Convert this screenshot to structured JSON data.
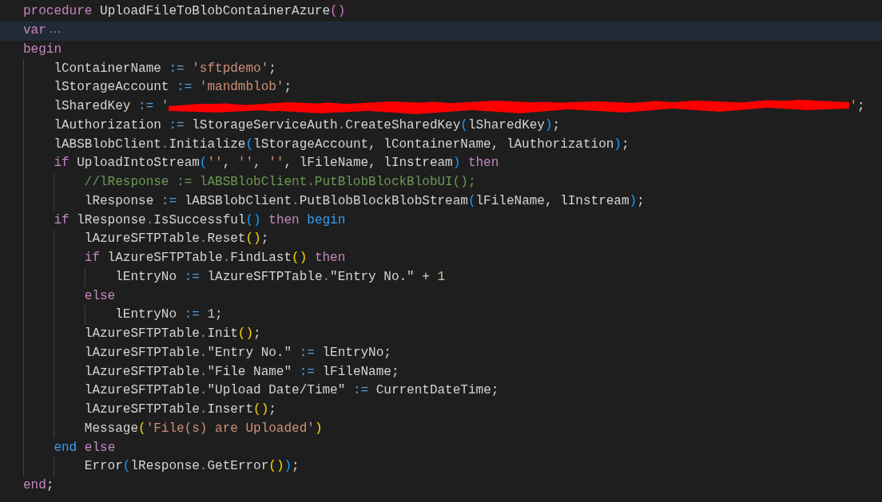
{
  "code_editor": {
    "lines": [
      {
        "current": false,
        "folded": false,
        "tokens": [
          {
            "text": "procedure",
            "kind": "keyword"
          },
          {
            "text": " UploadFileToBlobContainerAzure",
            "kind": "plain"
          },
          {
            "text": "(",
            "kind": "bracket",
            "color": "#da70d6"
          },
          {
            "text": ")",
            "kind": "bracket",
            "color": "#da70d6"
          }
        ]
      },
      {
        "current": true,
        "folded": true,
        "tokens": [
          {
            "text": "var",
            "kind": "keyword"
          }
        ]
      },
      {
        "current": false,
        "folded": false,
        "tokens": [
          {
            "text": "begin",
            "kind": "keyword"
          }
        ],
        "children": [
          {
            "current": false,
            "folded": false,
            "tokens": [
              {
                "text": "lContainerName ",
                "kind": "plain"
              },
              {
                "text": ":= ",
                "kind": "operator"
              },
              {
                "text": "'sftpdemo'",
                "kind": "string"
              },
              {
                "text": ";",
                "kind": "plain"
              }
            ]
          },
          {
            "current": false,
            "folded": false,
            "tokens": [
              {
                "text": "lStorageAccount ",
                "kind": "plain"
              },
              {
                "text": ":= ",
                "kind": "operator"
              },
              {
                "text": "'mandmblob'",
                "kind": "string"
              },
              {
                "text": ";",
                "kind": "plain"
              }
            ]
          },
          {
            "current": false,
            "folded": false,
            "tokens": [
              {
                "text": "lSharedKey ",
                "kind": "plain"
              },
              {
                "text": ":= ",
                "kind": "operator"
              },
              {
                "text": "'",
                "kind": "string"
              },
              {
                "kind": "redacted"
              },
              {
                "text": "'",
                "kind": "string"
              },
              {
                "text": ";",
                "kind": "plain"
              }
            ]
          },
          {
            "current": false,
            "folded": false,
            "tokens": [
              {
                "text": "lAuthorization ",
                "kind": "plain"
              },
              {
                "text": ":= ",
                "kind": "operator"
              },
              {
                "text": "lStorageServiceAuth",
                "kind": "plain"
              },
              {
                "text": ".",
                "kind": "operator"
              },
              {
                "text": "CreateSharedKey",
                "kind": "plain"
              },
              {
                "text": "(",
                "kind": "bracket",
                "color": "#179fff"
              },
              {
                "text": "lSharedKey",
                "kind": "plain"
              },
              {
                "text": ")",
                "kind": "bracket",
                "color": "#179fff"
              },
              {
                "text": ";",
                "kind": "plain"
              }
            ]
          },
          {
            "current": false,
            "folded": false,
            "tokens": [
              {
                "text": "lABSBlobClient",
                "kind": "plain"
              },
              {
                "text": ".",
                "kind": "operator"
              },
              {
                "text": "Initialize",
                "kind": "plain"
              },
              {
                "text": "(",
                "kind": "bracket",
                "color": "#179fff"
              },
              {
                "text": "lStorageAccount, lContainerName, lAuthorization",
                "kind": "plain"
              },
              {
                "text": ")",
                "kind": "bracket",
                "color": "#179fff"
              },
              {
                "text": ";",
                "kind": "plain"
              }
            ]
          },
          {
            "current": false,
            "folded": false,
            "tokens": [
              {
                "text": "if",
                "kind": "keyword"
              },
              {
                "text": " UploadIntoStream",
                "kind": "plain"
              },
              {
                "text": "(",
                "kind": "bracket",
                "color": "#179fff"
              },
              {
                "text": "''",
                "kind": "string"
              },
              {
                "text": ", ",
                "kind": "plain"
              },
              {
                "text": "''",
                "kind": "string"
              },
              {
                "text": ", ",
                "kind": "plain"
              },
              {
                "text": "''",
                "kind": "string"
              },
              {
                "text": ", lFileName, lInstream",
                "kind": "plain"
              },
              {
                "text": ")",
                "kind": "bracket",
                "color": "#179fff"
              },
              {
                "text": " then",
                "kind": "keyword"
              }
            ],
            "children": [
              {
                "current": false,
                "folded": false,
                "tokens": [
                  {
                    "text": "//lResponse := lABSBlobClient.PutBlobBlockBlobUI();",
                    "kind": "comment"
                  }
                ]
              },
              {
                "current": false,
                "folded": false,
                "tokens": [
                  {
                    "text": "lResponse ",
                    "kind": "plain"
                  },
                  {
                    "text": ":= ",
                    "kind": "operator"
                  },
                  {
                    "text": "lABSBlobClient",
                    "kind": "plain"
                  },
                  {
                    "text": ".",
                    "kind": "operator"
                  },
                  {
                    "text": "PutBlobBlockBlobStream",
                    "kind": "plain"
                  },
                  {
                    "text": "(",
                    "kind": "bracket",
                    "color": "#179fff"
                  },
                  {
                    "text": "lFileName, lInstream",
                    "kind": "plain"
                  },
                  {
                    "text": ")",
                    "kind": "bracket",
                    "color": "#179fff"
                  },
                  {
                    "text": ";",
                    "kind": "plain"
                  }
                ]
              }
            ]
          },
          {
            "current": false,
            "folded": false,
            "tokens": [
              {
                "text": "if",
                "kind": "keyword"
              },
              {
                "text": " lResponse",
                "kind": "plain"
              },
              {
                "text": ".",
                "kind": "operator"
              },
              {
                "text": "IsSuccessful",
                "kind": "plain"
              },
              {
                "text": "(",
                "kind": "bracket",
                "color": "#179fff"
              },
              {
                "text": ")",
                "kind": "bracket",
                "color": "#179fff"
              },
              {
                "text": " then",
                "kind": "keyword"
              },
              {
                "text": " begin",
                "kind": "block"
              }
            ],
            "children": [
              {
                "current": false,
                "folded": false,
                "tokens": [
                  {
                    "text": "lAzureSFTPTable",
                    "kind": "plain"
                  },
                  {
                    "text": ".",
                    "kind": "operator"
                  },
                  {
                    "text": "Reset",
                    "kind": "plain"
                  },
                  {
                    "text": "(",
                    "kind": "bracket",
                    "color": "#ffd700"
                  },
                  {
                    "text": ")",
                    "kind": "bracket",
                    "color": "#ffd700"
                  },
                  {
                    "text": ";",
                    "kind": "plain"
                  }
                ]
              },
              {
                "current": false,
                "folded": false,
                "tokens": [
                  {
                    "text": "if",
                    "kind": "keyword"
                  },
                  {
                    "text": " lAzureSFTPTable",
                    "kind": "plain"
                  },
                  {
                    "text": ".",
                    "kind": "operator"
                  },
                  {
                    "text": "FindLast",
                    "kind": "plain"
                  },
                  {
                    "text": "(",
                    "kind": "bracket",
                    "color": "#ffd700"
                  },
                  {
                    "text": ")",
                    "kind": "bracket",
                    "color": "#ffd700"
                  },
                  {
                    "text": " then",
                    "kind": "keyword"
                  }
                ],
                "children": [
                  {
                    "current": false,
                    "folded": false,
                    "tokens": [
                      {
                        "text": "lEntryNo ",
                        "kind": "plain"
                      },
                      {
                        "text": ":= ",
                        "kind": "operator"
                      },
                      {
                        "text": "lAzureSFTPTable",
                        "kind": "plain"
                      },
                      {
                        "text": ".",
                        "kind": "operator"
                      },
                      {
                        "text": "\"Entry No.\" + ",
                        "kind": "plain"
                      },
                      {
                        "text": "1",
                        "kind": "number"
                      }
                    ]
                  }
                ]
              },
              {
                "current": false,
                "folded": false,
                "tokens": [
                  {
                    "text": "else",
                    "kind": "keyword"
                  }
                ],
                "children": [
                  {
                    "current": false,
                    "folded": false,
                    "tokens": [
                      {
                        "text": "lEntryNo ",
                        "kind": "plain"
                      },
                      {
                        "text": ":= ",
                        "kind": "operator"
                      },
                      {
                        "text": "1",
                        "kind": "number"
                      },
                      {
                        "text": ";",
                        "kind": "plain"
                      }
                    ]
                  }
                ]
              },
              {
                "current": false,
                "folded": false,
                "tokens": [
                  {
                    "text": "lAzureSFTPTable",
                    "kind": "plain"
                  },
                  {
                    "text": ".",
                    "kind": "operator"
                  },
                  {
                    "text": "Init",
                    "kind": "plain"
                  },
                  {
                    "text": "(",
                    "kind": "bracket",
                    "color": "#ffd700"
                  },
                  {
                    "text": ")",
                    "kind": "bracket",
                    "color": "#ffd700"
                  },
                  {
                    "text": ";",
                    "kind": "plain"
                  }
                ]
              },
              {
                "current": false,
                "folded": false,
                "tokens": [
                  {
                    "text": "lAzureSFTPTable",
                    "kind": "plain"
                  },
                  {
                    "text": ".",
                    "kind": "operator"
                  },
                  {
                    "text": "\"Entry No.\" ",
                    "kind": "plain"
                  },
                  {
                    "text": ":= ",
                    "kind": "operator"
                  },
                  {
                    "text": "lEntryNo;",
                    "kind": "plain"
                  }
                ]
              },
              {
                "current": false,
                "folded": false,
                "tokens": [
                  {
                    "text": "lAzureSFTPTable",
                    "kind": "plain"
                  },
                  {
                    "text": ".",
                    "kind": "operator"
                  },
                  {
                    "text": "\"File Name\" ",
                    "kind": "plain"
                  },
                  {
                    "text": ":= ",
                    "kind": "operator"
                  },
                  {
                    "text": "lFileName;",
                    "kind": "plain"
                  }
                ]
              },
              {
                "current": false,
                "folded": false,
                "tokens": [
                  {
                    "text": "lAzureSFTPTable",
                    "kind": "plain"
                  },
                  {
                    "text": ".",
                    "kind": "operator"
                  },
                  {
                    "text": "\"Upload Date/Time\" ",
                    "kind": "plain"
                  },
                  {
                    "text": ":= ",
                    "kind": "operator"
                  },
                  {
                    "text": "CurrentDateTime;",
                    "kind": "plain"
                  }
                ]
              },
              {
                "current": false,
                "folded": false,
                "tokens": [
                  {
                    "text": "lAzureSFTPTable",
                    "kind": "plain"
                  },
                  {
                    "text": ".",
                    "kind": "operator"
                  },
                  {
                    "text": "Insert",
                    "kind": "plain"
                  },
                  {
                    "text": "(",
                    "kind": "bracket",
                    "color": "#ffd700"
                  },
                  {
                    "text": ")",
                    "kind": "bracket",
                    "color": "#ffd700"
                  },
                  {
                    "text": ";",
                    "kind": "plain"
                  }
                ]
              },
              {
                "current": false,
                "folded": false,
                "tokens": [
                  {
                    "text": "Message",
                    "kind": "plain"
                  },
                  {
                    "text": "(",
                    "kind": "bracket",
                    "color": "#ffd700"
                  },
                  {
                    "text": "'File(s) are Uploaded'",
                    "kind": "string"
                  },
                  {
                    "text": ")",
                    "kind": "bracket",
                    "color": "#ffd700"
                  }
                ]
              }
            ]
          },
          {
            "current": false,
            "folded": false,
            "tokens": [
              {
                "text": "end",
                "kind": "block"
              },
              {
                "text": " else",
                "kind": "keyword"
              }
            ],
            "children": [
              {
                "current": false,
                "folded": false,
                "tokens": [
                  {
                    "text": "Error",
                    "kind": "plain"
                  },
                  {
                    "text": "(",
                    "kind": "bracket",
                    "color": "#179fff"
                  },
                  {
                    "text": "lResponse",
                    "kind": "plain"
                  },
                  {
                    "text": ".",
                    "kind": "operator"
                  },
                  {
                    "text": "GetError",
                    "kind": "plain"
                  },
                  {
                    "text": "(",
                    "kind": "bracket",
                    "color": "#ffd700"
                  },
                  {
                    "text": ")",
                    "kind": "bracket",
                    "color": "#ffd700"
                  },
                  {
                    "text": ")",
                    "kind": "bracket",
                    "color": "#179fff"
                  },
                  {
                    "text": ";",
                    "kind": "plain"
                  }
                ]
              }
            ]
          }
        ]
      },
      {
        "current": false,
        "folded": false,
        "tokens": [
          {
            "text": "end",
            "kind": "keyword"
          },
          {
            "text": ";",
            "kind": "plain"
          }
        ]
      }
    ]
  }
}
